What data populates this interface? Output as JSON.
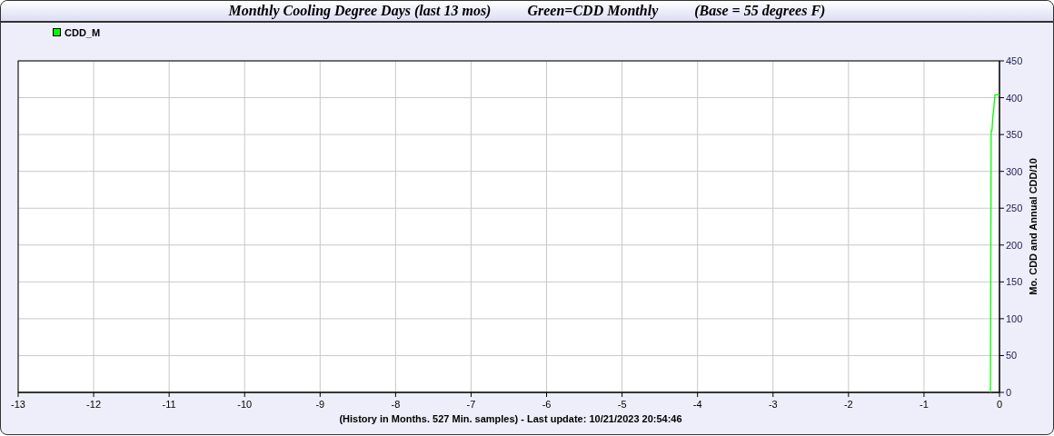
{
  "window": {
    "title": "Monthly Cooling Degree Days (last 13 mos)          Green=CDD Monthly          (Base = 55 degrees F)"
  },
  "chart": {
    "chart_data": {
      "type": "line",
      "grid": true,
      "xlabel": "(History in Months. 527 Min. samples) - Last update: 10/21/2023 20:54:46",
      "ylabel": "Mo. CDD and Annual CDD/10",
      "xlim": [
        -13,
        0
      ],
      "ylim": [
        0,
        450
      ],
      "xticks": [
        -13,
        -12,
        -11,
        -10,
        -9,
        -8,
        -7,
        -6,
        -5,
        -4,
        -3,
        -2,
        -1,
        0
      ],
      "yticks": [
        0,
        50,
        100,
        150,
        200,
        250,
        300,
        350,
        400,
        450
      ],
      "x": [
        -0.12,
        -0.11,
        -0.1,
        -0.085,
        -0.08,
        -0.06,
        0
      ],
      "series": [
        {
          "name": "CDD_M",
          "color": "#00ff00",
          "values": [
            0,
            355,
            355,
            378,
            380,
            404,
            404
          ]
        }
      ]
    }
  }
}
